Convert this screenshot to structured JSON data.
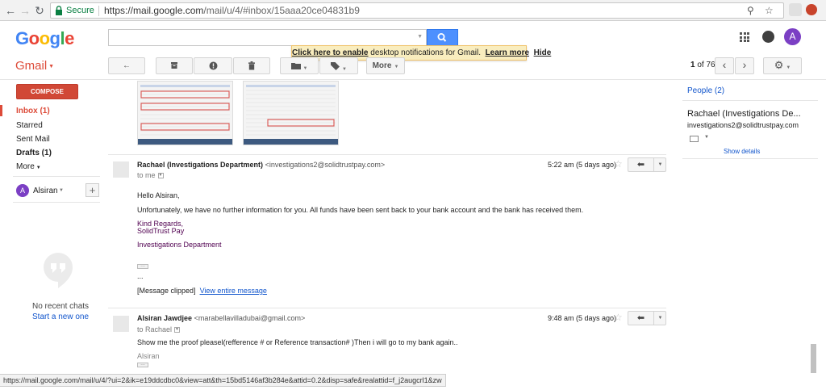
{
  "browser": {
    "secure_label": "Secure",
    "url_host": "https://mail.google.com",
    "url_path": "/mail/u/4/#inbox/15aaa20ce04831b9",
    "status_url": "https://mail.google.com/mail/u/4/?ui=2&ik=e19ddcdbc0&view=att&th=15bd5146af3b284e&attid=0.2&disp=safe&realattid=f_j2augcrl1&zw"
  },
  "header": {
    "logo": "Google",
    "avatar_letter": "A"
  },
  "notification": {
    "enable_link": "Click here to enable",
    "text": " desktop notifications for Gmail.",
    "learn_more": "Learn more",
    "hide": "Hide"
  },
  "toolbar": {
    "app_label": "Gmail",
    "more_label": "More",
    "pager_bold": "1",
    "pager_rest": " of 76"
  },
  "sidebar": {
    "compose": "COMPOSE",
    "inbox": "Inbox (1)",
    "starred": "Starred",
    "sent": "Sent Mail",
    "drafts": "Drafts (1)",
    "more": "More",
    "hangout_avatar": "A",
    "hangout_name": "Alsiran",
    "no_chats": "No recent chats",
    "start_new": "Start a new one"
  },
  "messages": [
    {
      "sender": "Rachael (Investigations Department)",
      "email": "<investigations2@solidtrustpay.com>",
      "to": "to me",
      "time": "5:22 am (5 days ago)",
      "greeting": "Hello Alsiran,",
      "body": "Unfortunately, we have no further information for you. All funds have been sent back to your bank account and the bank has received them.",
      "sig1": "Kind Regards,",
      "sig2": "SolidTrust Pay",
      "sig3": "Investigations Department",
      "ellipsis": "...",
      "clipped": "[Message clipped]",
      "view_entire": "View entire message"
    },
    {
      "sender": "Alsiran Jawdjee",
      "email": "<marabellavilladubai@gmail.com>",
      "to": "to Rachael",
      "time": "9:48 am (5 days ago)",
      "body": "Show me the proof pleasel(refference # or Reference transaction# )Then i will go to my bank again..",
      "sig": "Alsiran"
    }
  ],
  "right_panel": {
    "people": "People (2)",
    "name": "Rachael (Investigations De...",
    "email": "investigations2@solidtrustpay.com",
    "show_details": "Show details"
  },
  "colors": {
    "gmail_red": "#dd4b39",
    "compose_red": "#d14836",
    "search_blue": "#4d90fe",
    "link_blue": "#1155cc",
    "signature_purple": "#500050",
    "avatar_purple": "#7b3fc4"
  },
  "icons": {
    "reply": "reply-icon",
    "archive": "archive-icon",
    "spam": "report-spam-icon",
    "delete": "trash-icon",
    "move": "folder-icon",
    "labels": "label-icon",
    "settings": "gear-icon"
  }
}
